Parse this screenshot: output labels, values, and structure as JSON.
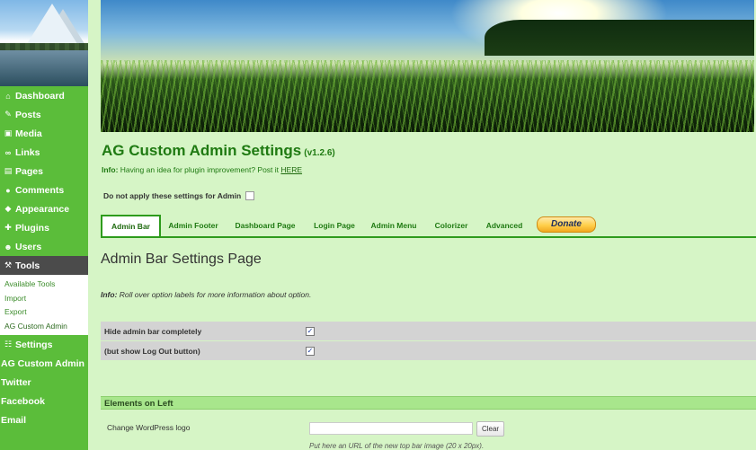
{
  "sidebar": {
    "items": [
      {
        "label": "Dashboard",
        "icon": "home-icon"
      },
      {
        "label": "Posts",
        "icon": "pin-icon"
      },
      {
        "label": "Media",
        "icon": "media-icon"
      },
      {
        "label": "Links",
        "icon": "link-icon"
      },
      {
        "label": "Pages",
        "icon": "pages-icon"
      },
      {
        "label": "Comments",
        "icon": "comment-icon"
      },
      {
        "label": "Appearance",
        "icon": "appearance-icon"
      },
      {
        "label": "Plugins",
        "icon": "plugin-icon"
      },
      {
        "label": "Users",
        "icon": "users-icon"
      },
      {
        "label": "Tools",
        "icon": "tools-icon"
      }
    ],
    "tools_submenu": [
      "Available Tools",
      "Import",
      "Export",
      "AG Custom Admin"
    ],
    "after_items": [
      {
        "label": "Settings",
        "icon": "settings-icon"
      },
      {
        "label": "AG Custom Admin"
      },
      {
        "label": "Twitter"
      },
      {
        "label": "Facebook"
      },
      {
        "label": "Email"
      }
    ]
  },
  "header": {
    "title": "AG Custom Admin Settings",
    "version": "(v1.2.6)",
    "info_label": "Info:",
    "info_text": "Having an idea for plugin improvement? Post it",
    "info_link": "HERE",
    "admin_skip_label": "Do not apply these settings for Admin"
  },
  "tabs": [
    "Admin Bar",
    "Admin Footer",
    "Dashboard Page",
    "Login Page",
    "Admin Menu",
    "Colorizer",
    "Advanced"
  ],
  "donate_label": "Donate",
  "content": {
    "heading": "Admin Bar Settings Page",
    "info_label": "Info:",
    "info_text": "Roll over option labels for more information about option.",
    "options": [
      {
        "label": "Hide admin bar completely",
        "checked": true,
        "mark": "✓"
      },
      {
        "label": "(but show Log Out button)",
        "checked": true,
        "mark": "✓"
      }
    ],
    "group_title": "Elements on Left",
    "logo_label": "Change WordPress logo",
    "logo_value": "",
    "clear_label": "Clear",
    "logo_help": "Put here an URL of the new top bar image (20 x 20px)."
  },
  "colors": {
    "sidebar": "#5bbd3a",
    "accent": "#2e9b1c",
    "page_bg": "#d6f5c6"
  }
}
